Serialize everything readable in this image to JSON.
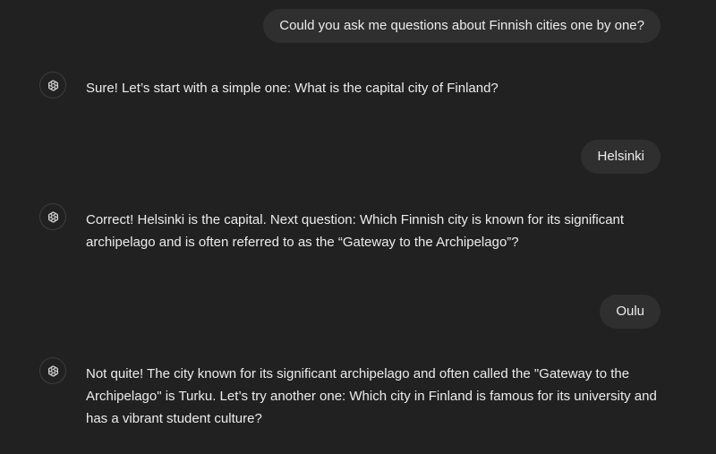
{
  "conversation": {
    "messages": [
      {
        "role": "user",
        "text": "Could you ask me questions about Finnish cities one by one?"
      },
      {
        "role": "assistant",
        "icon": "openai-logo-icon",
        "text": "Sure! Let’s start with a simple one: What is the capital city of Finland?"
      },
      {
        "role": "user",
        "text": "Helsinki"
      },
      {
        "role": "assistant",
        "icon": "openai-logo-icon",
        "text": "Correct! Helsinki is the capital. Next question: Which Finnish city is known for its significant archipelago and is often referred to as the “Gateway to the Archipelago”?"
      },
      {
        "role": "user",
        "text": "Oulu"
      },
      {
        "role": "assistant",
        "icon": "openai-logo-icon",
        "text": "Not quite! The city known for its significant archipelago and often called the \"Gateway to the Archipelago\" is Turku. Let’s try another one: Which city in Finland is famous for its university and has a vibrant student culture?"
      }
    ]
  },
  "colors": {
    "background": "#212121",
    "user_bubble": "#2f2f2f",
    "text": "#ececec"
  }
}
